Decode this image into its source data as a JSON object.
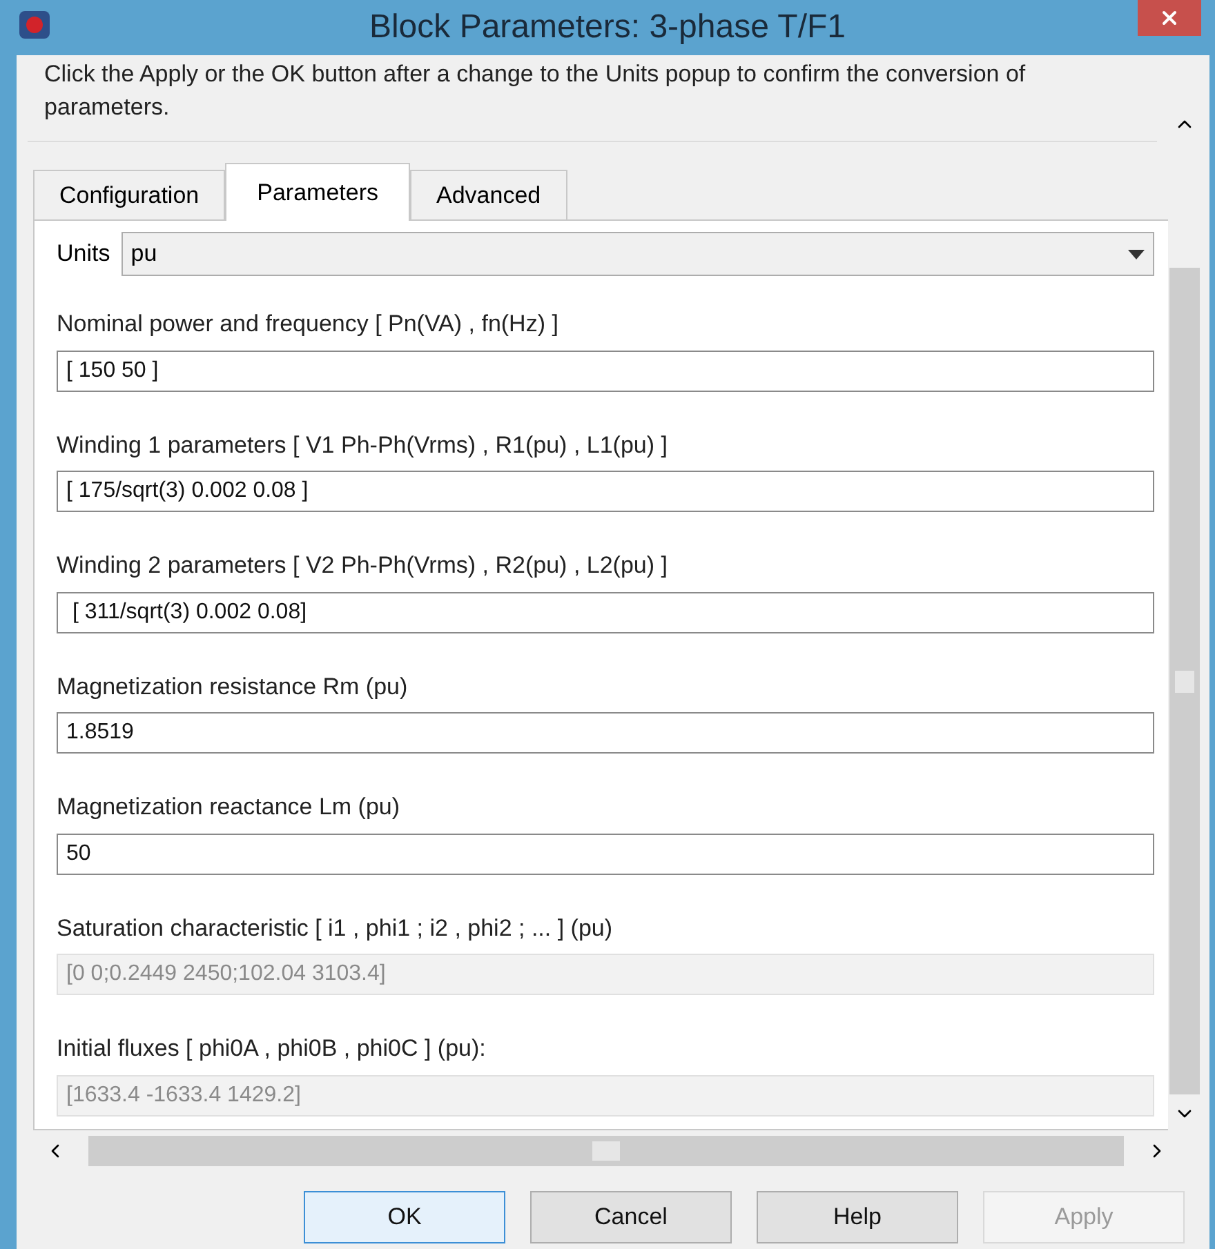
{
  "window": {
    "title": "Block Parameters: 3-phase T/F1"
  },
  "description": "Click the Apply or the OK button after a change to the Units popup to confirm the conversion of parameters.",
  "tabs": [
    {
      "label": "Configuration",
      "selected": false
    },
    {
      "label": "Parameters",
      "selected": true
    },
    {
      "label": "Advanced",
      "selected": false
    }
  ],
  "units": {
    "label": "Units",
    "value": "pu"
  },
  "parameters": [
    {
      "label": "Nominal power and frequency  [ Pn(VA) , fn(Hz) ]",
      "value": "[ 150 50 ]",
      "disabled": false
    },
    {
      "label": "Winding 1 parameters [ V1 Ph-Ph(Vrms) , R1(pu) , L1(pu) ]",
      "value": "[ 175/sqrt(3) 0.002 0.08 ]",
      "disabled": false
    },
    {
      "label": "Winding 2 parameters [ V2 Ph-Ph(Vrms) , R2(pu) , L2(pu) ]",
      "value": " [ 311/sqrt(3) 0.002 0.08]",
      "disabled": false
    },
    {
      "label": "Magnetization resistance  Rm (pu)",
      "value": "1.8519",
      "disabled": false
    },
    {
      "label": "Magnetization reactance  Lm (pu)",
      "value": "50",
      "disabled": false
    },
    {
      "label": "Saturation characteristic [ i1 ,  phi1 ;  i2 , phi2 ; ... ] (pu)",
      "value": "[0 0;0.2449 2450;102.04 3103.4]",
      "disabled": true
    },
    {
      "label": "Initial fluxes [ phi0A , phi0B , phi0C ] (pu):",
      "value": "[1633.4 -1633.4 1429.2]",
      "disabled": true
    }
  ],
  "buttons": [
    {
      "label": "OK",
      "default": true,
      "disabled": false
    },
    {
      "label": "Cancel",
      "default": false,
      "disabled": false
    },
    {
      "label": "Help",
      "default": false,
      "disabled": false
    },
    {
      "label": "Apply",
      "default": false,
      "disabled": true
    }
  ]
}
